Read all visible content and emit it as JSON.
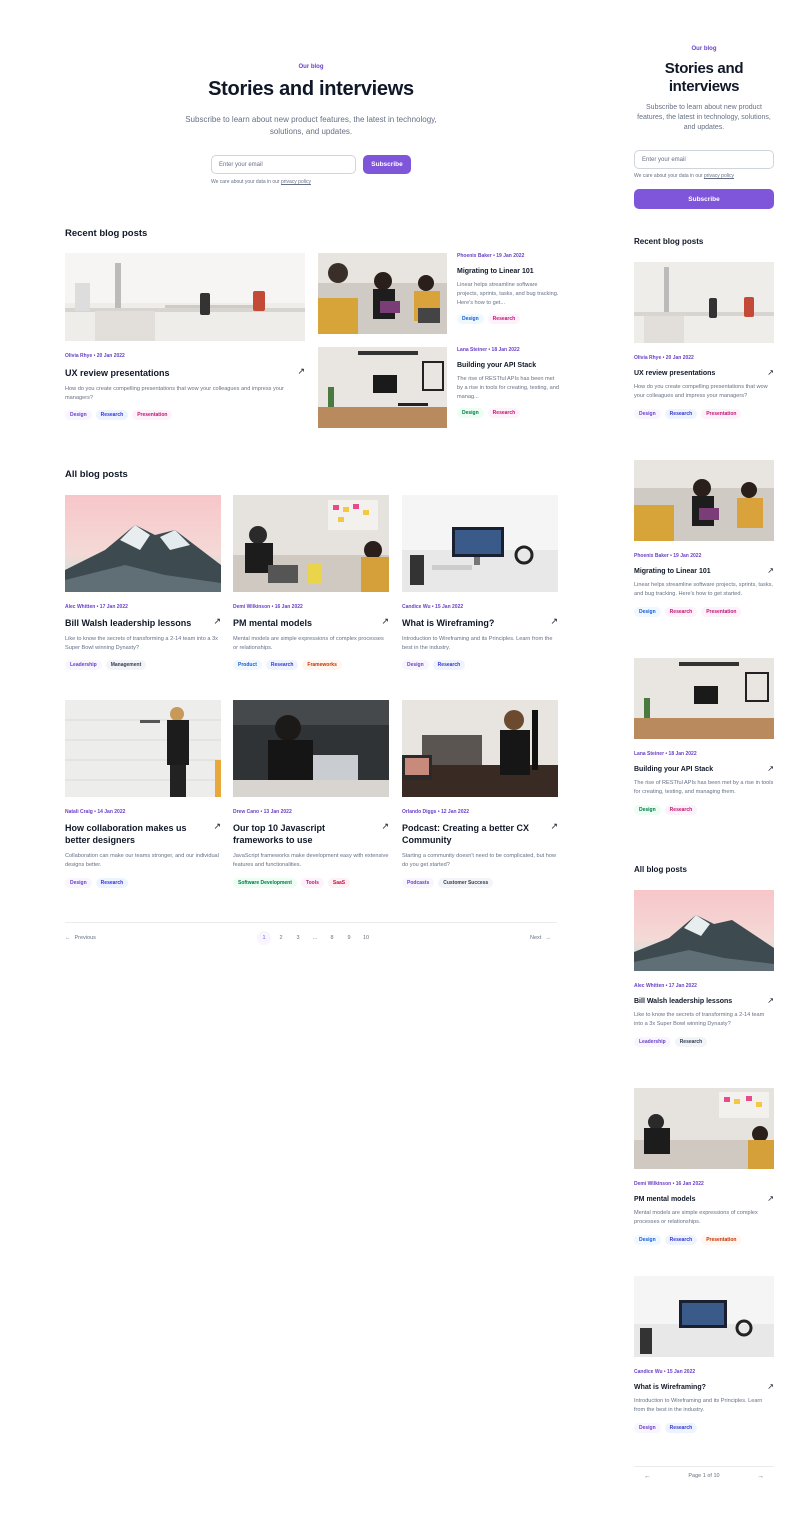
{
  "colors": {
    "accent": "#7f56d9",
    "eyebrow": "#6941c6",
    "text": "#101828",
    "muted": "#667085"
  },
  "desktop": {
    "hero": {
      "eyebrow": "Our blog",
      "title": "Stories and interviews",
      "subtitle": "Subscribe to learn about new product features, the latest in technology, solutions, and updates.",
      "email_placeholder": "Enter your email",
      "subscribe": "Subscribe",
      "note_prefix": "We care about your data in our ",
      "note_link": "privacy policy"
    },
    "recent_title": "Recent blog posts",
    "recent": [
      {
        "meta": "Olivia Rhye • 20 Jan 2022",
        "title": "UX review presentations",
        "desc": "How do you create compelling presentations that wow your colleagues and impress your managers?",
        "tags": [
          "Design",
          "Research",
          "Presentation"
        ]
      },
      {
        "meta": "Phoenix Baker • 19 Jan 2022",
        "title": "Migrating to Linear 101",
        "desc": "Linear helps streamline software projects, sprints, tasks, and bug tracking. Here's how to get...",
        "tags": [
          "Design",
          "Research"
        ]
      },
      {
        "meta": "Lana Steiner • 18 Jan 2022",
        "title": "Building your API Stack",
        "desc": "The rise of RESTful APIs has been met by a rise in tools for creating, testing, and manag...",
        "tags": [
          "Design",
          "Research"
        ]
      }
    ],
    "all_title": "All blog posts",
    "all": [
      {
        "meta": "Alec Whitten • 17 Jan 2022",
        "title": "Bill Walsh leadership lessons",
        "desc": "Like to know the secrets of transforming a 2-14 team into a 3x Super Bowl winning Dynasty?",
        "tags": [
          "Leadership",
          "Management"
        ]
      },
      {
        "meta": "Demi Wilkinson • 16 Jan 2022",
        "title": "PM mental models",
        "desc": "Mental models are simple expressions of complex processes or relationships.",
        "tags": [
          "Product",
          "Research",
          "Frameworks"
        ]
      },
      {
        "meta": "Candice Wu • 15 Jan 2022",
        "title": "What is Wireframing?",
        "desc": "Introduction to Wireframing and its Principles. Learn from the best in the industry.",
        "tags": [
          "Design",
          "Research"
        ]
      },
      {
        "meta": "Natali Craig • 14 Jan 2022",
        "title": "How collaboration makes us better designers",
        "desc": "Collaboration can make our teams stronger, and our individual designs better.",
        "tags": [
          "Design",
          "Research"
        ]
      },
      {
        "meta": "Drew Cano • 13 Jan 2022",
        "title": "Our top 10 Javascript frameworks to use",
        "desc": "JavaScript frameworks make development easy with extensive features and functionalities.",
        "tags": [
          "Software Development",
          "Tools",
          "SaaS"
        ]
      },
      {
        "meta": "Orlando Diggs • 12 Jan 2022",
        "title": "Podcast: Creating a better CX Community",
        "desc": "Starting a community doesn't need to be complicated, but how do you get started?",
        "tags": [
          "Podcasts",
          "Customer Success"
        ]
      }
    ],
    "pagination": {
      "previous": "Previous",
      "next": "Next",
      "pages": [
        "1",
        "2",
        "3",
        "...",
        "8",
        "9",
        "10"
      ]
    }
  },
  "mobile": {
    "hero": {
      "eyebrow": "Our blog",
      "title_line1": "Stories and",
      "title_line2": "interviews",
      "subtitle": "Subscribe to learn about new product features, the latest in technology, solutions, and updates.",
      "email_placeholder": "Enter your email",
      "subscribe": "Subscribe",
      "note_prefix": "We care about your data in our ",
      "note_link": "privacy policy"
    },
    "recent_title": "Recent blog posts",
    "recent": [
      {
        "meta": "Olivia Rhye • 20 Jan 2022",
        "title": "UX review presentations",
        "desc": "How do you create compelling presentations that wow your colleagues and impress your managers?",
        "tags": [
          "Design",
          "Research",
          "Presentation"
        ]
      },
      {
        "meta": "Phoenix Baker • 19 Jan 2022",
        "title": "Migrating to Linear 101",
        "desc": "Linear helps streamline software projects, sprints, tasks, and bug tracking. Here's how to get started.",
        "tags": [
          "Design",
          "Research",
          "Presentation"
        ]
      },
      {
        "meta": "Lana Steiner • 18 Jan 2022",
        "title": "Building your API Stack",
        "desc": "The rise of RESTful APIs has been met by a rise in tools for creating, testing, and managing them.",
        "tags": [
          "Design",
          "Research"
        ]
      }
    ],
    "all_title": "All blog posts",
    "all": [
      {
        "meta": "Alec Whitten • 17 Jan 2022",
        "title": "Bill Walsh leadership lessons",
        "desc": "Like to know the secrets of transforming a 2-14 team into a 3x Super Bowl winning Dynasty?",
        "tags": [
          "Leadership",
          "Research"
        ]
      },
      {
        "meta": "Demi Wilkinson • 16 Jan 2022",
        "title": "PM mental models",
        "desc": "Mental models are simple expressions of complex processes or relationships.",
        "tags": [
          "Design",
          "Research",
          "Presentation"
        ]
      },
      {
        "meta": "Candice Wu • 15 Jan 2022",
        "title": "What is Wireframing?",
        "desc": "Introduction to Wireframing and its Principles. Learn from the best in the industry.",
        "tags": [
          "Design",
          "Research"
        ]
      }
    ],
    "pagination": {
      "page_label": "Page 1 of 10"
    }
  }
}
